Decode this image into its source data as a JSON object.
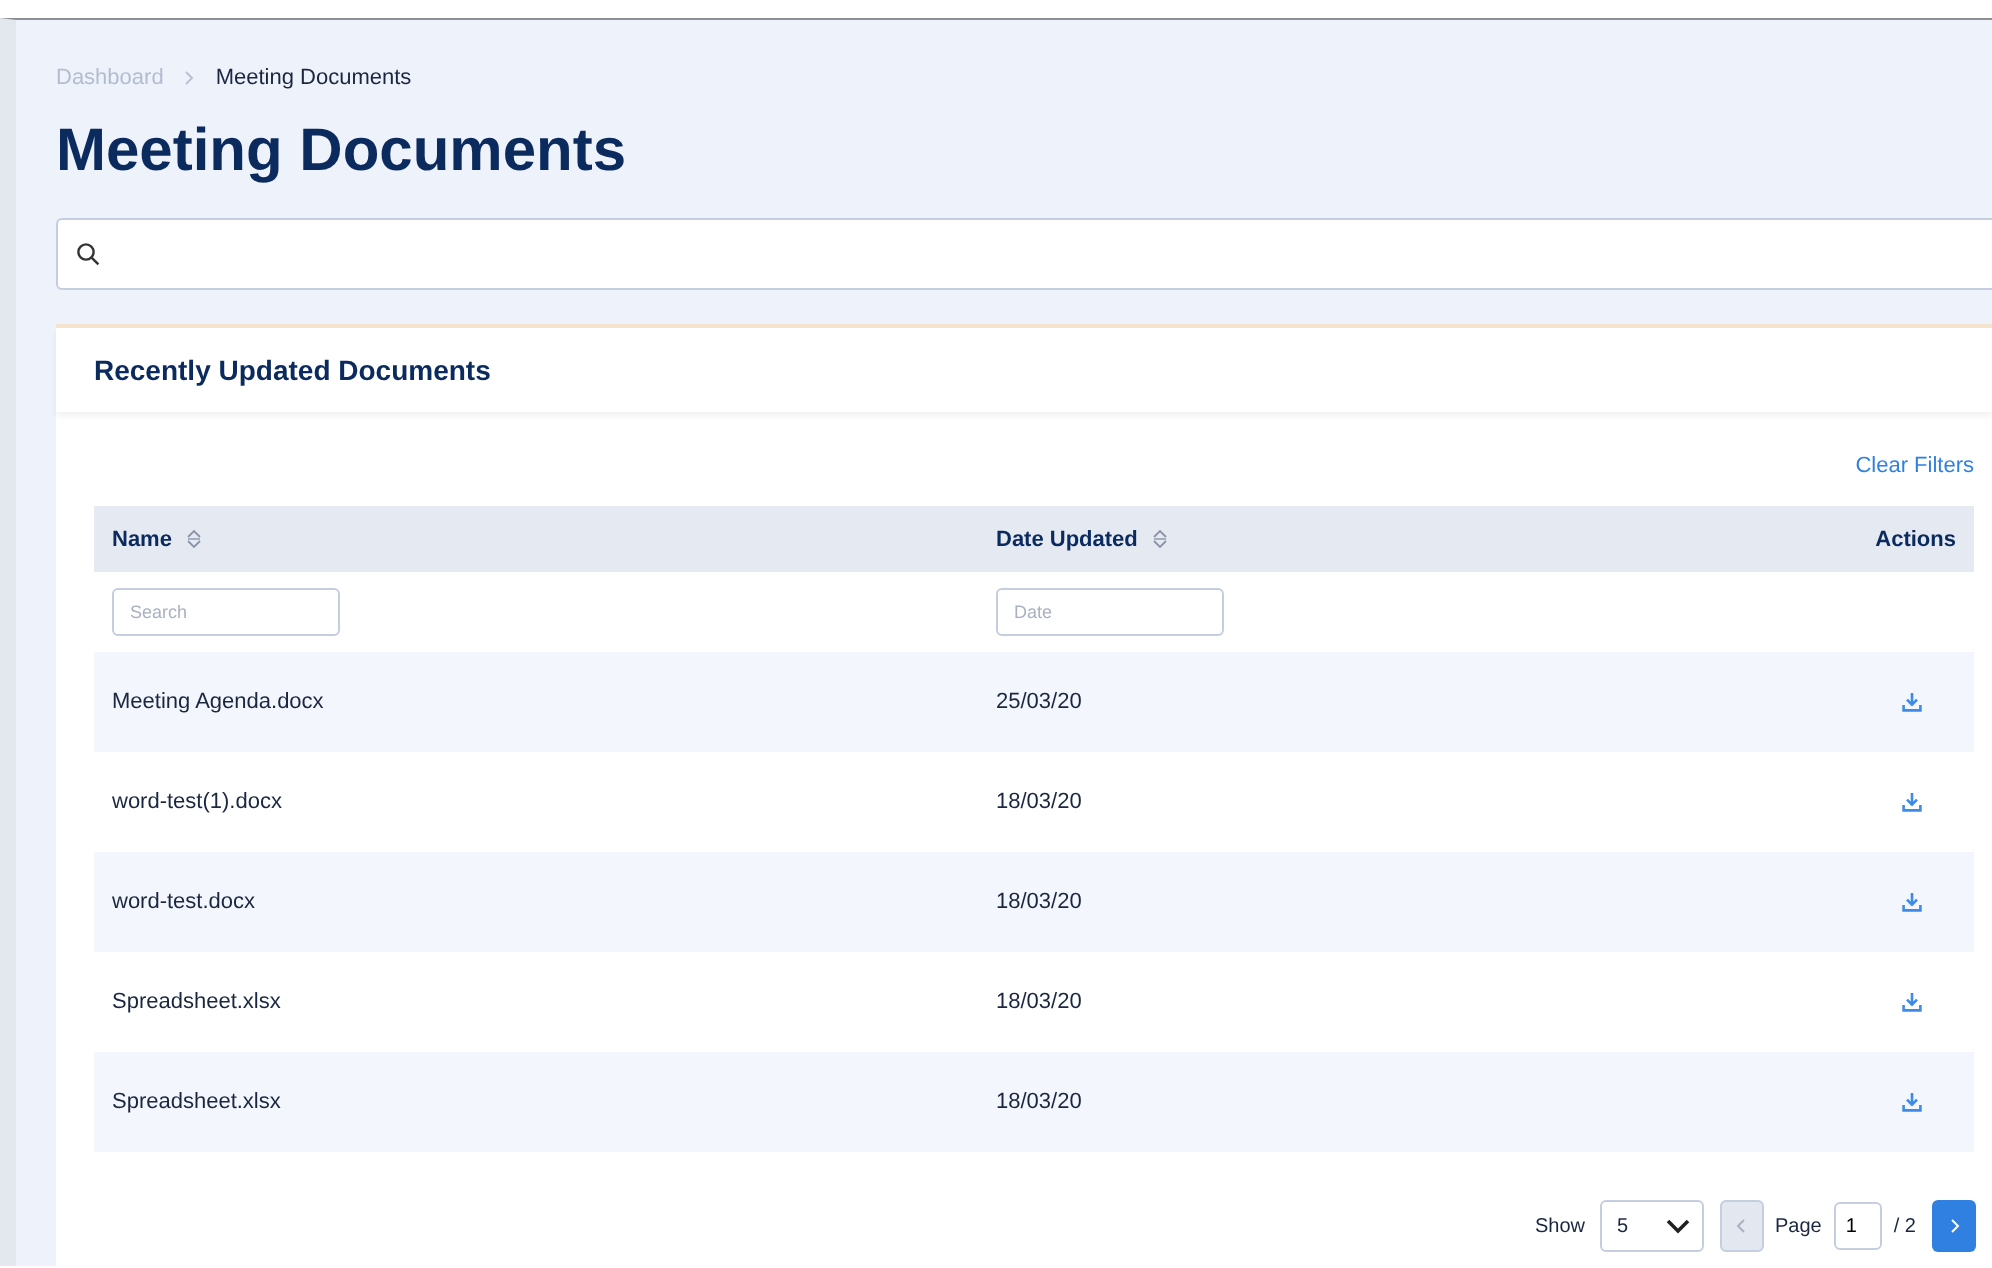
{
  "breadcrumb": [
    {
      "label": "Dashboard",
      "current": false
    },
    {
      "label": "Meeting Documents",
      "current": true
    }
  ],
  "title": "Meeting Documents",
  "card": {
    "title": "Recently Updated Documents",
    "clear_filters": "Clear Filters",
    "columns": [
      {
        "label": "Name",
        "sortable": true,
        "filter_placeholder": "Search"
      },
      {
        "label": "Date Updated",
        "sortable": true,
        "filter_placeholder": "Date"
      },
      {
        "label": "Actions",
        "sortable": false
      }
    ],
    "rows": [
      {
        "name": "Meeting Agenda.docx",
        "date": "25/03/20"
      },
      {
        "name": "word-test(1).docx",
        "date": "18/03/20"
      },
      {
        "name": "word-test.docx",
        "date": "18/03/20"
      },
      {
        "name": "Spreadsheet.xlsx",
        "date": "18/03/20"
      },
      {
        "name": "Spreadsheet.xlsx",
        "date": "18/03/20"
      }
    ],
    "pagination": {
      "show_label": "Show",
      "page_size": "5",
      "page_label": "Page",
      "page": "1",
      "total": "/ 2",
      "prev_disabled": true,
      "next_disabled": false
    }
  }
}
